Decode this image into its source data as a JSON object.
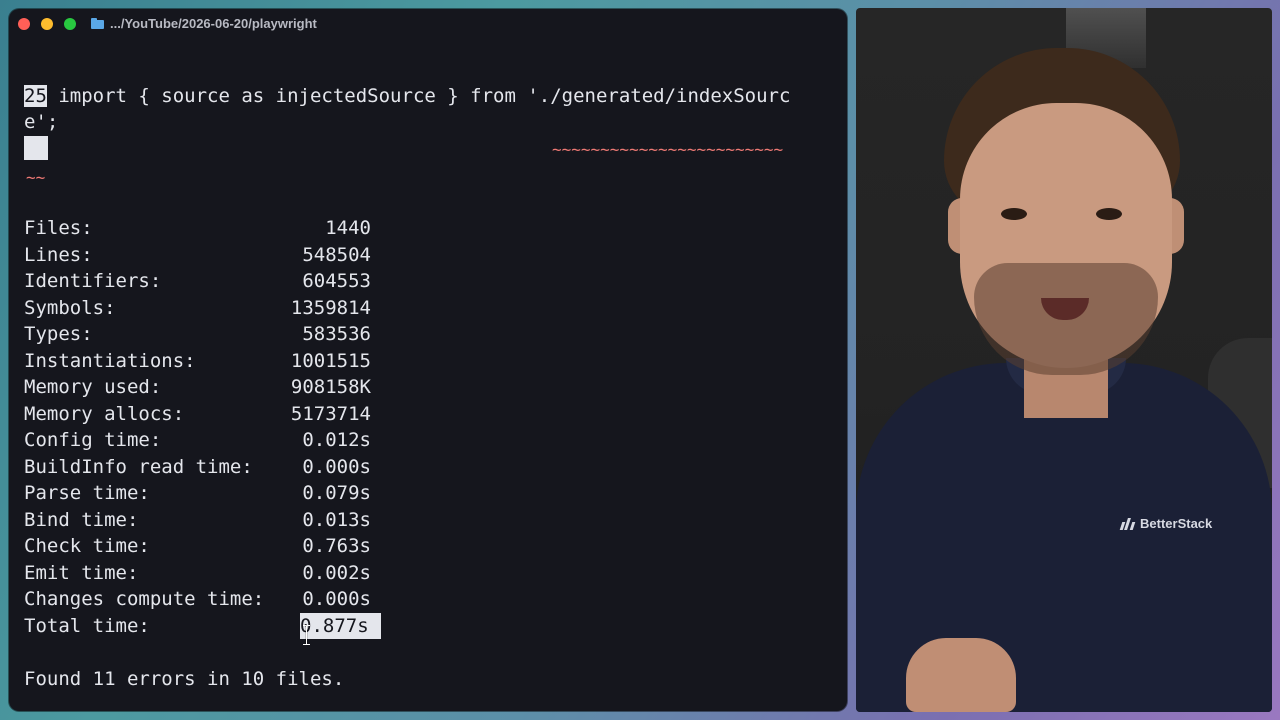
{
  "window": {
    "title": ".../YouTube/2026-06-20/playwright"
  },
  "error": {
    "line_number": "25",
    "code_start": " import { source as injectedSource } from './generated/indexSourc",
    "code_wrap": "e';",
    "squiggle_main": "~~~~~~~~~~~~~~~~~~~~~~~~",
    "squiggle_wrap": "~~"
  },
  "stats": [
    {
      "label": "Files:",
      "value": "1440"
    },
    {
      "label": "Lines:",
      "value": "548504"
    },
    {
      "label": "Identifiers:",
      "value": "604553"
    },
    {
      "label": "Symbols:",
      "value": "1359814"
    },
    {
      "label": "Types:",
      "value": "583536"
    },
    {
      "label": "Instantiations:",
      "value": "1001515"
    },
    {
      "label": "Memory used:",
      "value": "908158K"
    },
    {
      "label": "Memory allocs:",
      "value": "5173714"
    },
    {
      "label": "Config time:",
      "value": "0.012s"
    },
    {
      "label": "BuildInfo read time:",
      "value": "0.000s"
    },
    {
      "label": "Parse time:",
      "value": "0.079s"
    },
    {
      "label": "Bind time:",
      "value": "0.013s"
    },
    {
      "label": "Check time:",
      "value": "0.763s"
    },
    {
      "label": "Emit time:",
      "value": "0.002s"
    },
    {
      "label": "Changes compute time:",
      "value": "0.000s"
    },
    {
      "label": "Total time:",
      "value": "0.877s"
    }
  ],
  "summary": "Found 11 errors in 10 files.",
  "webcam": {
    "shirt_logo": "BetterStack"
  },
  "colors": {
    "terminal_bg": "#15161d",
    "text": "#e4e6ec",
    "error_squiggle": "#f07a75"
  }
}
